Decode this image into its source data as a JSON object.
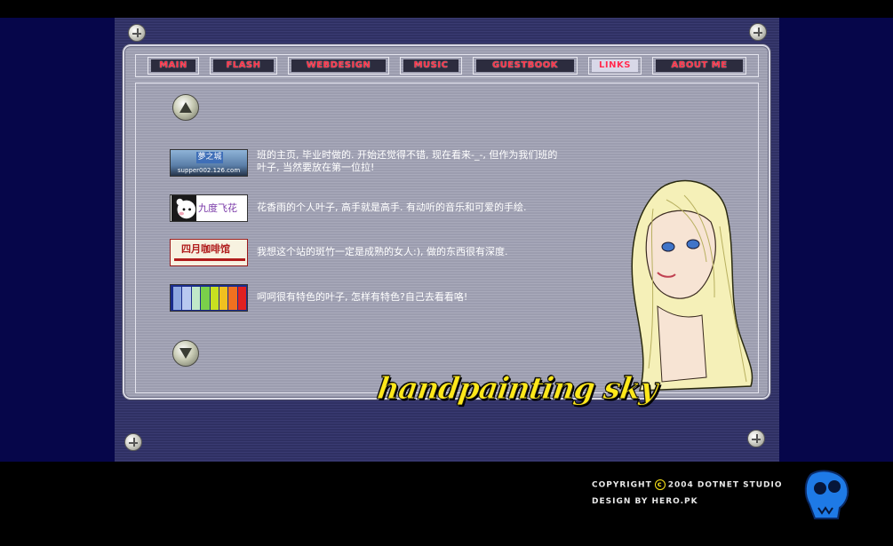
{
  "nav": {
    "tabs": [
      {
        "label": "MAIN"
      },
      {
        "label": "FLASH"
      },
      {
        "label": "WEBDESIGN"
      },
      {
        "label": "MUSIC"
      },
      {
        "label": "GUESTBOOK"
      },
      {
        "label": "LINKS"
      },
      {
        "label": "ABOUT ME"
      }
    ],
    "active_tab": "LINKS"
  },
  "links": [
    {
      "banner_text": "夢之城",
      "banner_subtext": "supper002.126.com",
      "description": "班的主页, 毕业时做的. 开始还觉得不错, 现在看来-_-, 但作为我们班的叶子, 当然要放在第一位拉!"
    },
    {
      "banner_text": "九度飞花",
      "description": "花香雨的个人叶子, 高手就是高手. 有动听的音乐和可爱的手绘."
    },
    {
      "banner_text": "四月咖啡馆",
      "description": "我想这个站的斑竹一定是成熟的女人:), 做的东西很有深度."
    },
    {
      "banner_text": "",
      "description": "呵呵很有特色的叶子, 怎样有特色?自己去看看咯!"
    }
  ],
  "logo_text": "handpainting sky",
  "footer": {
    "copyright_prefix": "COPYRIGHT",
    "copyright_symbol": "c",
    "copyright_suffix": "2004 DOTNET STUDIO",
    "design": "DESIGN BY HERO.PK"
  },
  "colors": {
    "navy": "#06064a",
    "tab_text": "#ff3348",
    "logo": "#ffe81a",
    "studio_logo": "#1e7ae6"
  },
  "icons": {
    "scroll_up": "triangle-up-icon",
    "scroll_down": "triangle-down-icon",
    "screws": "screw-icon",
    "studio": "skull-logo-icon"
  }
}
